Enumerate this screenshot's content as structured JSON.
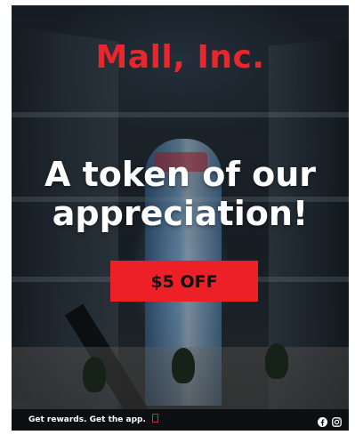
{
  "brand": {
    "name": "Mall, Inc."
  },
  "hero": {
    "headline": "A token of our appreciation!",
    "cta_label": "$5 OFF"
  },
  "footer": {
    "promo_text": "Get rewards. Get the app.",
    "icons": [
      "phone-icon",
      "facebook-icon",
      "instagram-icon"
    ]
  },
  "colors": {
    "brand_red": "#e8262d",
    "cta_red": "#ee2027",
    "footer_bg": "#0d0f12",
    "text_white": "#ffffff"
  }
}
